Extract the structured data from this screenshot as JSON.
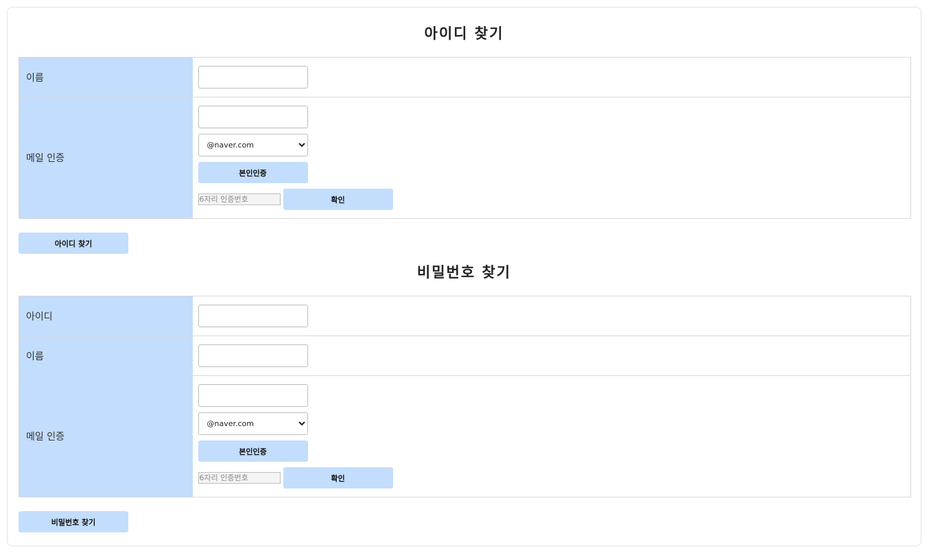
{
  "find_id": {
    "title": "아이디 찾기",
    "name_label": "이름",
    "email_label": "메일 인증",
    "domain_selected": "@naver.com",
    "verify_button": "본인인증",
    "code_placeholder": "6자리 인증번호",
    "confirm_button": "확인",
    "submit_button": "아이디 찾기"
  },
  "find_pw": {
    "title": "비밀번호 찾기",
    "id_label": "아이디",
    "name_label": "이름",
    "email_label": "메일 인증",
    "domain_selected": "@naver.com",
    "verify_button": "본인인증",
    "code_placeholder": "6자리 인증번호",
    "confirm_button": "확인",
    "submit_button": "비밀번호 찾기"
  }
}
